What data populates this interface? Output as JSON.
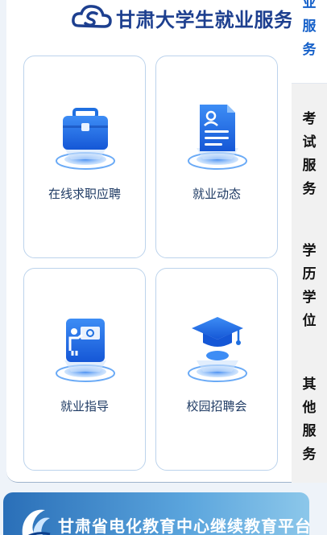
{
  "header": {
    "brand_title": "甘肃大学生就业服务平台",
    "logo_icon": "gansu-s-cloud-logo-icon",
    "brand_color": "#1d3f8f"
  },
  "cards": [
    {
      "label": "在线求职应聘",
      "icon": "briefcase-icon"
    },
    {
      "label": "就业动态",
      "icon": "document-profile-icon"
    },
    {
      "label": "就业指导",
      "icon": "teacher-presentation-icon"
    },
    {
      "label": "校园招聘会",
      "icon": "graduation-cap-icon"
    }
  ],
  "side_tabs": [
    {
      "chars": [
        "业",
        "服",
        "务"
      ],
      "active": true
    },
    {
      "chars": [
        "考",
        "试",
        "服",
        "务"
      ],
      "active": false
    },
    {
      "chars": [
        "学",
        "历",
        "学",
        "位"
      ],
      "active": false
    },
    {
      "chars": [
        "其",
        "他",
        "服",
        "务"
      ],
      "active": false
    }
  ],
  "banner": {
    "text": "甘肃省电化教育中心继续教育平台",
    "logo_icon": "education-center-logo-icon"
  },
  "colors": {
    "accent": "#1560c9",
    "card_border": "#bcd3ec",
    "icon_blue": "#1f6fe0",
    "inactive_tab_bg": "#f1f1f1"
  }
}
